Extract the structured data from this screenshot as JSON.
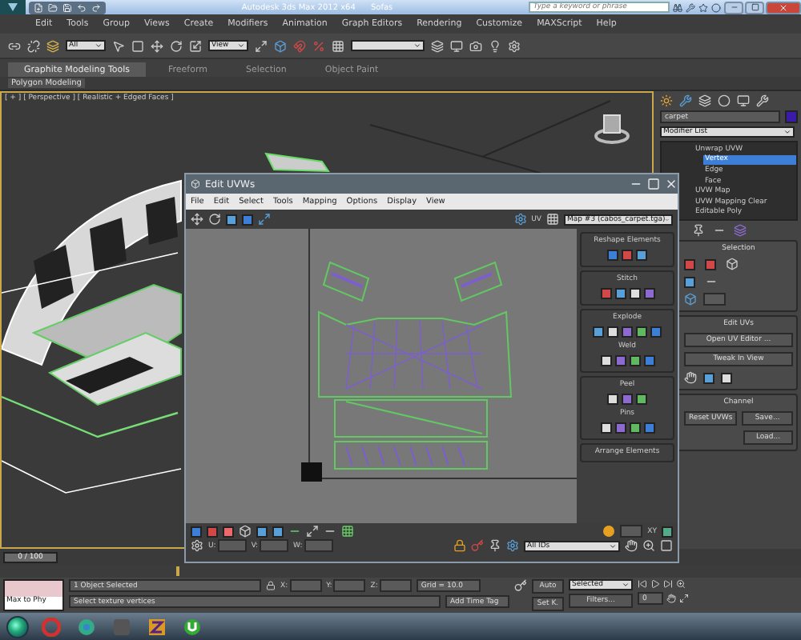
{
  "title_bar": {
    "title": "Autodesk 3ds Max 2012 x64",
    "file": "Sofas",
    "search": {
      "placeholder": "Type a keyword or phrase"
    }
  },
  "menu": [
    "Edit",
    "Tools",
    "Group",
    "Views",
    "Create",
    "Modifiers",
    "Animation",
    "Graph Editors",
    "Rendering",
    "Customize",
    "MAXScript",
    "Help"
  ],
  "main_toolbar": {
    "selection_filter": "All",
    "reference_coord": "View"
  },
  "ribbon": {
    "tabs": [
      {
        "label": "Graphite Modeling Tools",
        "selected": true
      },
      {
        "label": "Freeform",
        "selected": false
      },
      {
        "label": "Selection",
        "selected": false
      },
      {
        "label": "Object Paint",
        "selected": false
      }
    ],
    "panel": "Polygon Modeling"
  },
  "viewport": {
    "label": "[ + ] [ Perspective ] [ Realistic + Edged Faces ]"
  },
  "uv_editor": {
    "title": "Edit UVWs",
    "menu": [
      "File",
      "Edit",
      "Select",
      "Tools",
      "Mapping",
      "Options",
      "Display",
      "View"
    ],
    "uv_label": "UV",
    "map": "Map #3 (cabos_carpet.tga)",
    "rollouts": [
      {
        "title": "Reshape Elements"
      },
      {
        "title": "Stitch"
      },
      {
        "title": "Explode",
        "sub": "Weld"
      },
      {
        "title": "Peel",
        "sub": "Pins"
      },
      {
        "title": "Arrange Elements"
      }
    ],
    "fields": [
      "U:",
      "V:",
      "W:"
    ],
    "ids": "All IDs",
    "xy": "XY"
  },
  "command_panel": {
    "object_name": "carpet",
    "modifier_list": "Modifier List",
    "stack": [
      {
        "label": "Unwrap UVW",
        "selected": false,
        "children": [
          {
            "label": "Vertex",
            "selected": true
          },
          {
            "label": "Edge",
            "selected": false
          },
          {
            "label": "Face",
            "selected": false
          }
        ]
      },
      {
        "label": "UVW Map",
        "selected": false
      },
      {
        "label": "UVW Mapping Clear",
        "selected": false
      },
      {
        "label": "Editable Poly",
        "selected": false
      }
    ],
    "selection_title": "Selection",
    "edit_title": "Edit UVs",
    "edit_buttons": [
      "Open UV Editor ...",
      "Tweak In View"
    ],
    "channel_title": "Channel",
    "channel_buttons": [
      "Reset UVWs",
      "Save...",
      "Load..."
    ]
  },
  "timeline": {
    "frame": "0 / 100"
  },
  "status": {
    "selected": "1 Object Selected",
    "prompt": "Select texture vertices",
    "listener": "Max to Phy",
    "coords": [
      "X:",
      "Y:",
      "Z:"
    ],
    "grid": "Grid = 10.0",
    "time_tag": "Add Time Tag",
    "auto_key": "Auto",
    "set_key": "Set K.",
    "key_mode": "Selected",
    "filters": "Filters...",
    "frame": "0"
  }
}
